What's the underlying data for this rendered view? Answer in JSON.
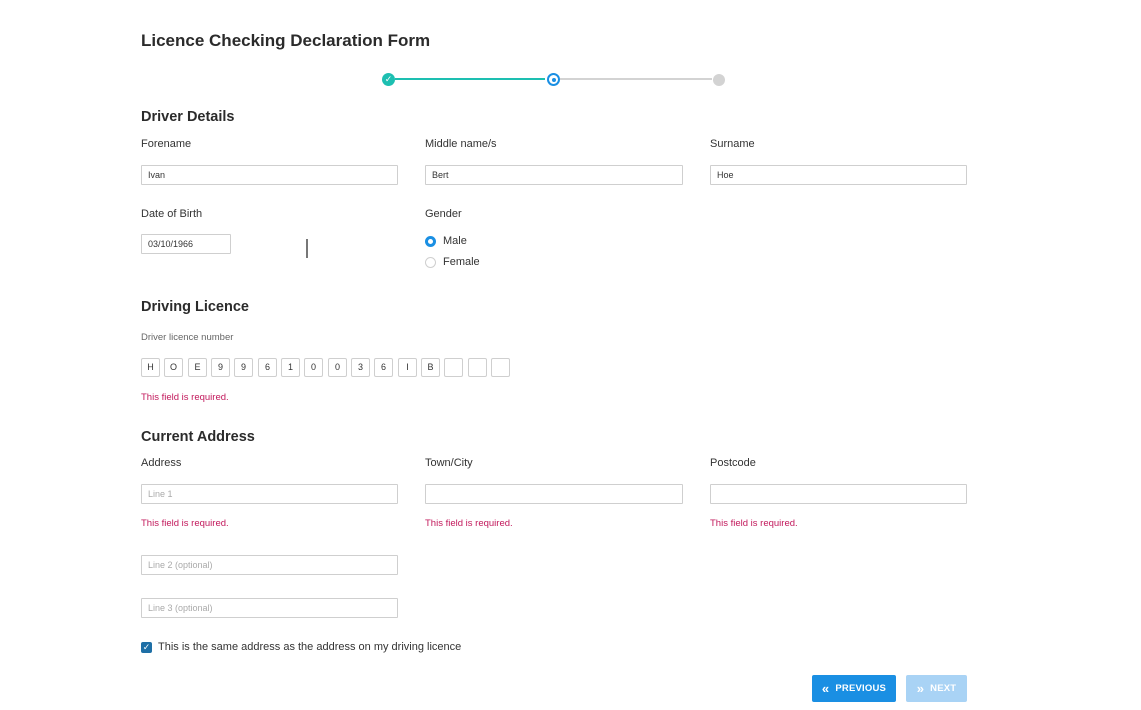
{
  "form": {
    "title": "Licence Checking Declaration Form"
  },
  "stepper": {
    "steps": [
      "done",
      "current",
      "pending"
    ],
    "done_icon": "✓"
  },
  "driver_details": {
    "heading": "Driver Details",
    "forename_label": "Forename",
    "forename_value": "Ivan",
    "middle_label": "Middle name/s",
    "middle_value": "Bert",
    "surname_label": "Surname",
    "surname_value": "Hoe",
    "dob_label": "Date of Birth",
    "dob_value": "03/10/1966",
    "gender_label": "Gender",
    "gender_options": [
      "Male",
      "Female"
    ],
    "gender_selected": "Male"
  },
  "driving_licence": {
    "heading": "Driving Licence",
    "number_label": "Driver licence number",
    "chars": [
      "H",
      "O",
      "E",
      "9",
      "9",
      "6",
      "1",
      "0",
      "0",
      "3",
      "6",
      "I",
      "B",
      "",
      "",
      ""
    ],
    "error": "This field is required."
  },
  "current_address": {
    "heading": "Current Address",
    "address_label": "Address",
    "line1_placeholder": "Line 1",
    "line2_placeholder": "Line 2 (optional)",
    "line3_placeholder": "Line 3 (optional)",
    "town_label": "Town/City",
    "postcode_label": "Postcode",
    "error": "This field is required.",
    "same_address_label": "This is the same address as the address on my driving licence",
    "same_address_checked": true
  },
  "buttons": {
    "previous": "PREVIOUS",
    "next": "NEXT",
    "previous_icon": "«",
    "next_icon": "»"
  },
  "colors": {
    "primary": "#1a8fe3",
    "teal": "#1dbfb1",
    "error": "#c2185b"
  }
}
